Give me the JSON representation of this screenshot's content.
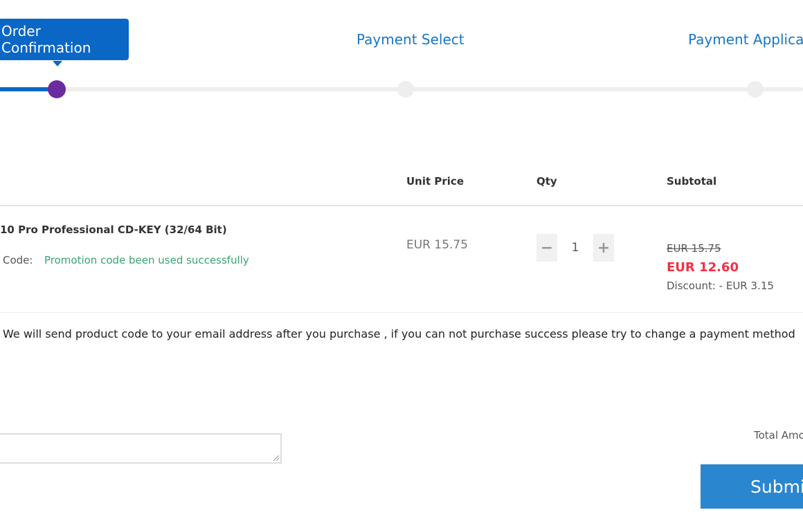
{
  "steps": [
    {
      "label": "Order Confirmation",
      "active": true
    },
    {
      "label": "Payment Select",
      "active": false
    },
    {
      "label": "Payment Applicati",
      "active": false
    }
  ],
  "table": {
    "headers": {
      "unit_price": "Unit Price",
      "qty": "Qty",
      "subtotal": "Subtotal"
    },
    "item": {
      "name": "10 Pro Professional CD-KEY (32/64 Bit)",
      "promo_label": "Code:",
      "promo_message": "Promotion code been used successfully",
      "unit_price": "EUR 15.75",
      "quantity": "1",
      "qty_minus": "−",
      "qty_plus": "+",
      "subtotal_original": "EUR 15.75",
      "subtotal_final": "EUR 12.60",
      "discount": "Discount: - EUR 3.15"
    }
  },
  "notice": "We will send product code to your email address after you purchase , if you can not purchase success please try to change a payment method",
  "total_label": "Total Amo",
  "submit_label": "Submi",
  "colors": {
    "primary": "#0a67c6",
    "step_dot_active": "#6a2c9e",
    "link": "#1577c7",
    "success": "#3aa46e",
    "price_red": "#ee3344",
    "submit_bg": "#2b86d0"
  }
}
